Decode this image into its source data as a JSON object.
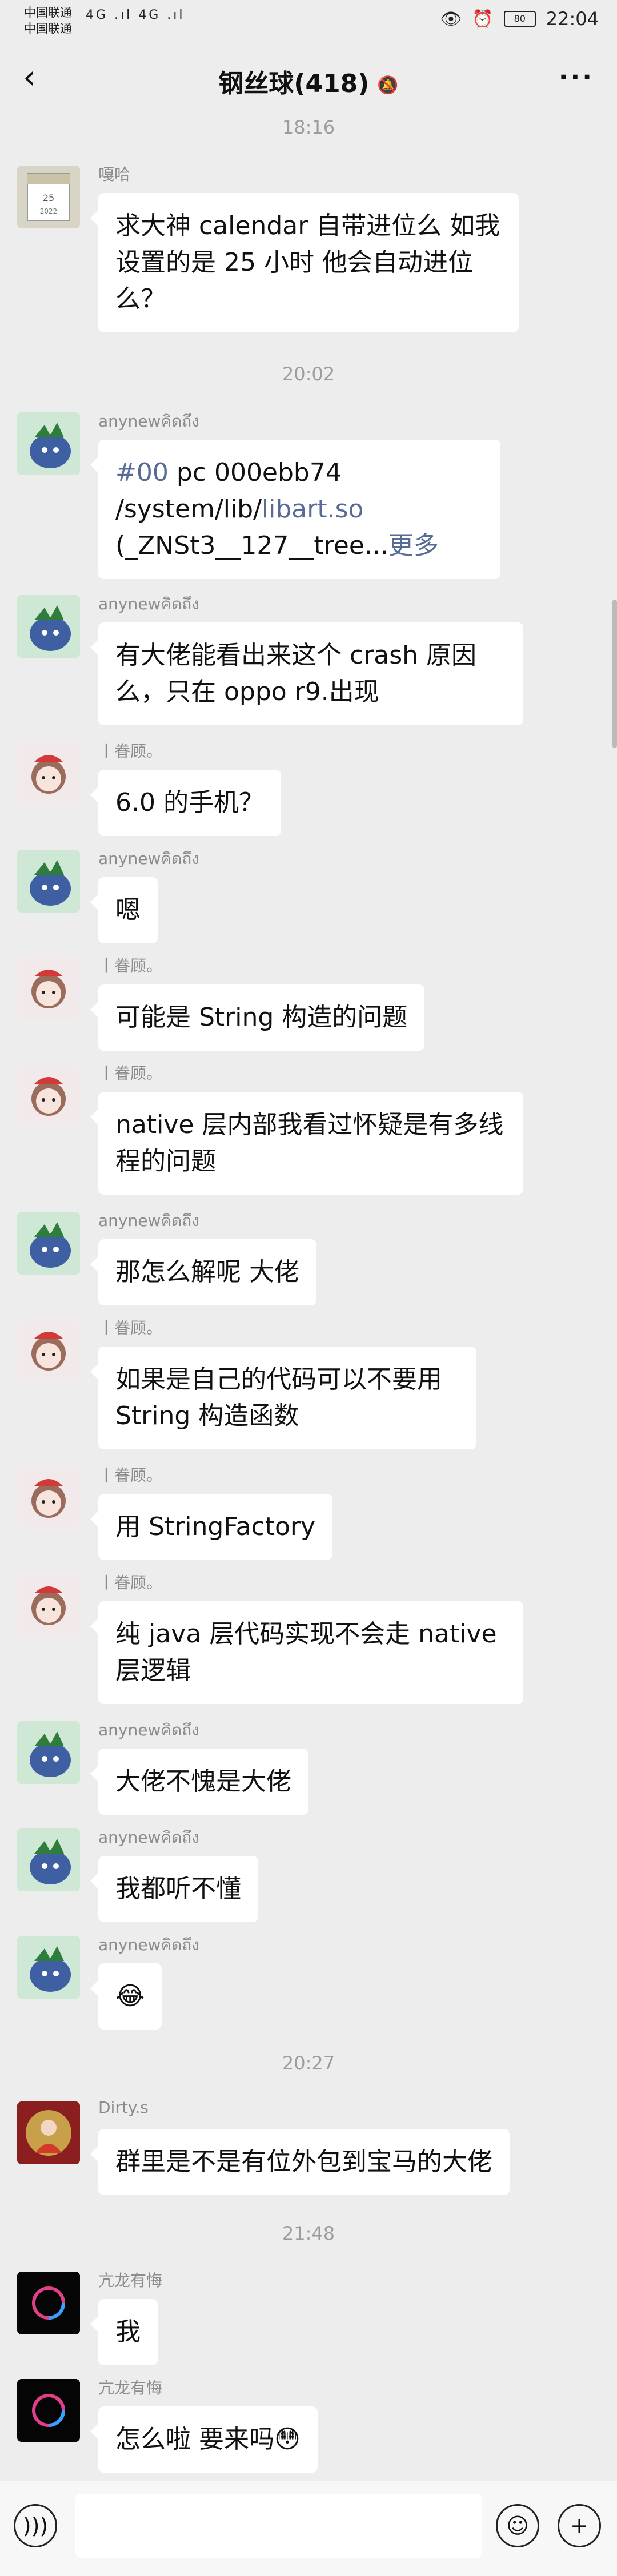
{
  "status": {
    "carrier_line1": "中国联通",
    "carrier_line2": "中国联通",
    "signal_text": "4G .ıl 4G .ıl",
    "time": "22:04",
    "battery": "80"
  },
  "header": {
    "title": "钢丝球(418)"
  },
  "times": {
    "t1": "18:16",
    "t2": "20:02",
    "t3": "20:27",
    "t4": "21:48"
  },
  "messages": [
    {
      "sender": "嘎哈",
      "text": "求大神 calendar 自带进位么 如我设置的是 25 小时 他会自动进位么？",
      "avatar": "calendar"
    },
    {
      "sender": "anynewคิดถึง",
      "text_link1": "#00",
      "text_mid": " pc 000ebb74 /system/lib/",
      "text_link2": "libart.so",
      "text_rest": " (_ZNSt3__127__tree...",
      "more": "更多",
      "avatar": "green"
    },
    {
      "sender": "anynewคิดถึง",
      "text": "有大佬能看出来这个 crash 原因么，只在 oppo r9.出现",
      "avatar": "green"
    },
    {
      "sender": "丨眷顾。",
      "text": "6.0 的手机？",
      "avatar": "pink"
    },
    {
      "sender": "anynewคิดถึง",
      "text": "嗯",
      "avatar": "green"
    },
    {
      "sender": "丨眷顾。",
      "text": "可能是 String 构造的问题",
      "avatar": "pink"
    },
    {
      "sender": "丨眷顾。",
      "text": "native 层内部我看过怀疑是有多线程的问题",
      "avatar": "pink"
    },
    {
      "sender": "anynewคิดถึง",
      "text": "那怎么解呢 大佬",
      "avatar": "green"
    },
    {
      "sender": "丨眷顾。",
      "text": "如果是自己的代码可以不要用 String 构造函数",
      "avatar": "pink"
    },
    {
      "sender": "丨眷顾。",
      "text": "用 StringFactory",
      "avatar": "pink"
    },
    {
      "sender": "丨眷顾。",
      "text": "纯 java 层代码实现不会走 native 层逻辑",
      "avatar": "pink"
    },
    {
      "sender": "anynewคิดถึง",
      "text": "大佬不愧是大佬",
      "avatar": "green"
    },
    {
      "sender": "anynewคิดถึง",
      "text": "我都听不懂",
      "avatar": "green"
    },
    {
      "sender": "anynewคิดถึง",
      "text": "😂",
      "avatar": "green"
    },
    {
      "sender": "Dirty.s",
      "text": "群里是不是有位外包到宝马的大佬",
      "avatar": "red"
    },
    {
      "sender": "亢龙有悔",
      "text": "我",
      "avatar": "dark"
    },
    {
      "sender": "亢龙有悔",
      "text": "怎么啦 要来吗😳",
      "avatar": "dark"
    }
  ],
  "input": {
    "voice_icon": "voice-icon",
    "emoji_icon": "emoji-icon",
    "plus_icon": "plus-icon"
  }
}
